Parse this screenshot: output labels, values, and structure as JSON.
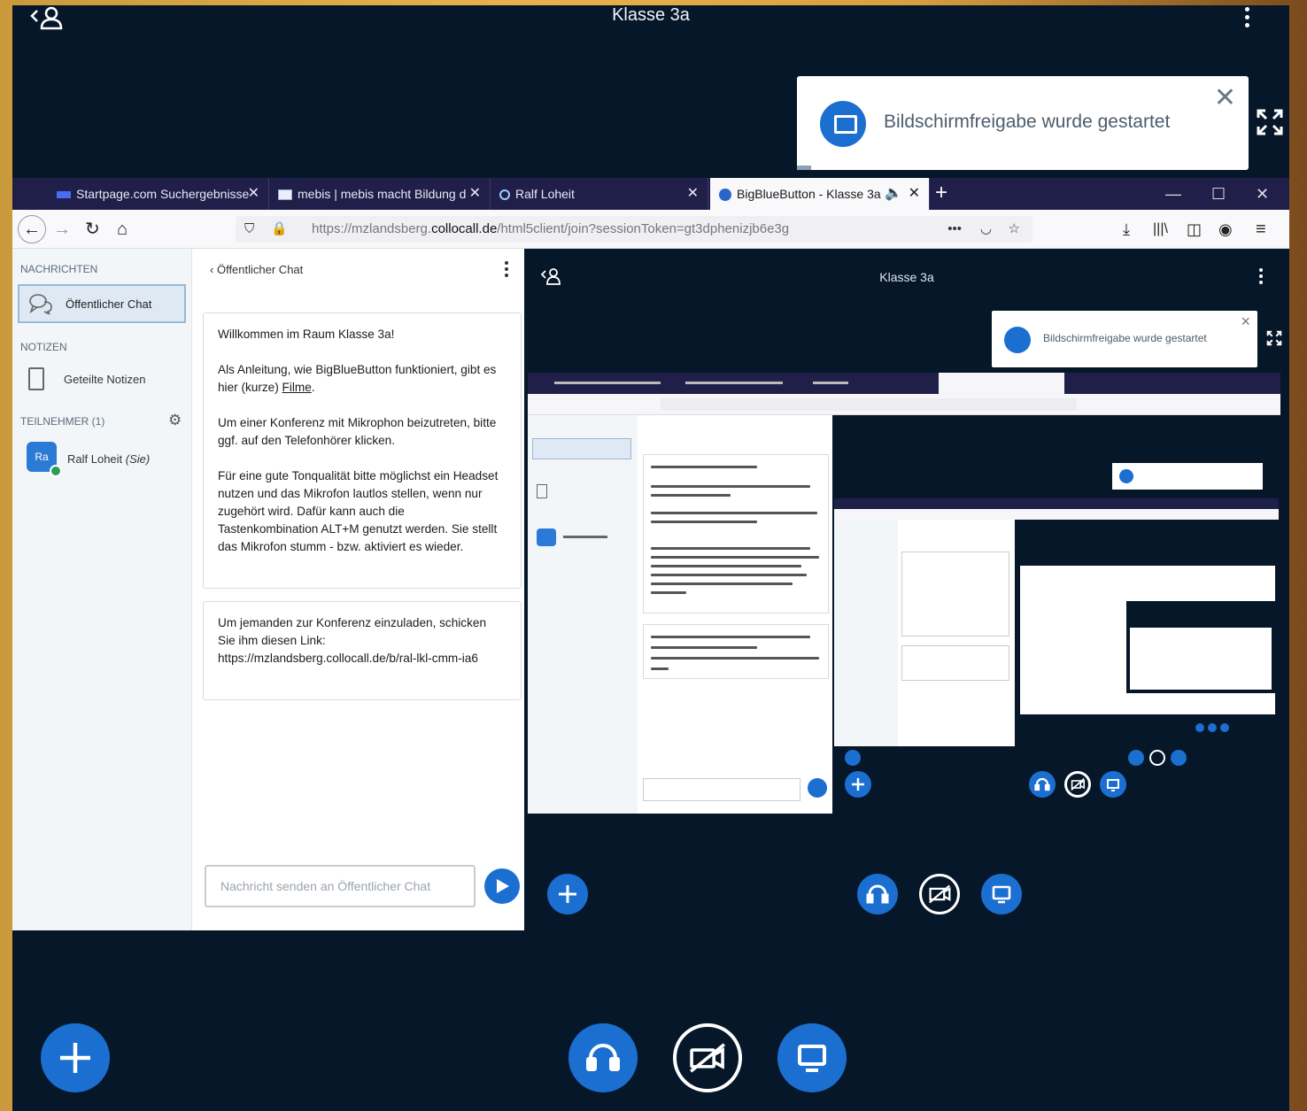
{
  "app": {
    "title": "Klasse 3a",
    "toast": {
      "message": "Bildschirmfreigabe wurde gestartet",
      "close": "✕"
    }
  },
  "browser": {
    "tabs": [
      {
        "label": "Startpage.com Suchergebnisse"
      },
      {
        "label": "mebis | mebis macht Bildung d"
      },
      {
        "label": "Ralf Loheit"
      },
      {
        "label": "BigBlueButton - Klasse 3a"
      }
    ],
    "new_tab": "+",
    "url_prefix": "https://mzlandsberg.",
    "url_domain": "collocall.de",
    "url_path": "/html5client/join?sessionToken=gt3dphenizjb6e3g"
  },
  "sidebar": {
    "messages_heading": "NACHRICHTEN",
    "public_chat": "Öffentlicher Chat",
    "notes_heading": "NOTIZEN",
    "shared_notes": "Geteilte Notizen",
    "participants_heading": "TEILNEHMER (1)",
    "user_initials": "Ra",
    "user_name": "Ralf Loheit",
    "user_you": "(Sie)"
  },
  "chat": {
    "back_label": "Öffentlicher Chat",
    "welcome_title": "Willkommen im Raum Klasse 3a!",
    "welcome_p1_a": "Als Anleitung, wie BigBlueButton funktioniert, gibt es hier (kurze)",
    "welcome_p1_link": "Filme",
    "welcome_p1_b": ".",
    "welcome_p2": "Um einer Konferenz mit Mikrophon beizutreten, bitte ggf. auf den Telefonhörer klicken.",
    "welcome_p3": "Für eine gute Tonqualität bitte möglichst ein Headset nutzen und das Mikrofon lautlos stellen, wenn nur zugehört wird. Dafür kann auch die Tastenkombination ALT+M genutzt werden. Sie stellt das Mikrofon stumm - bzw. aktiviert es wieder.",
    "invite_text": "Um jemanden zur Konferenz einzuladen, schicken Sie ihm diesen Link: https://mzlandsberg.collocall.de/b/ral-lkl-cmm-ia6",
    "input_placeholder": "Nachricht senden an Öffentlicher Chat"
  },
  "colors": {
    "primary": "#1b6fd1",
    "background": "#06172a",
    "tabbar": "#1f1f4a"
  },
  "icons": {
    "user_list": "user-list-toggle-icon",
    "more": "kebab-menu-icon",
    "screen_share": "screen-share-icon",
    "fullscreen": "fullscreen-icon",
    "plus": "plus-icon",
    "headphones": "headphones-icon",
    "camera_off": "video-off-icon",
    "send": "send-icon"
  }
}
